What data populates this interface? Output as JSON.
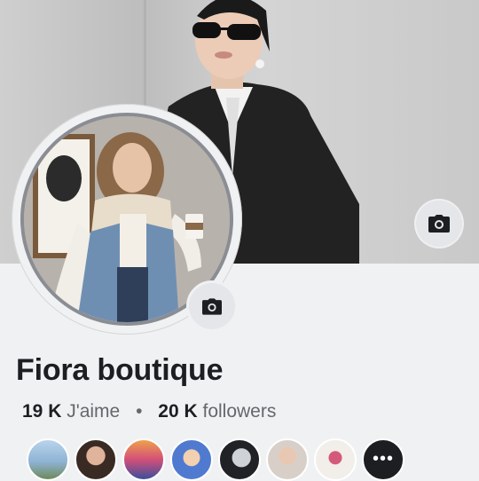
{
  "page": {
    "name": "Fiora boutique",
    "likes_count": "19 K",
    "likes_label": "J'aime",
    "separator": "•",
    "followers_count": "20 K",
    "followers_label": "followers"
  },
  "icons": {
    "cover_camera": "camera-icon",
    "avatar_camera": "camera-icon",
    "more": "more-dots-icon"
  },
  "friends": {
    "more_label": "•••"
  },
  "colors": {
    "background": "#f0f1f3",
    "text_primary": "#1c1e21",
    "text_secondary": "#65676b"
  }
}
